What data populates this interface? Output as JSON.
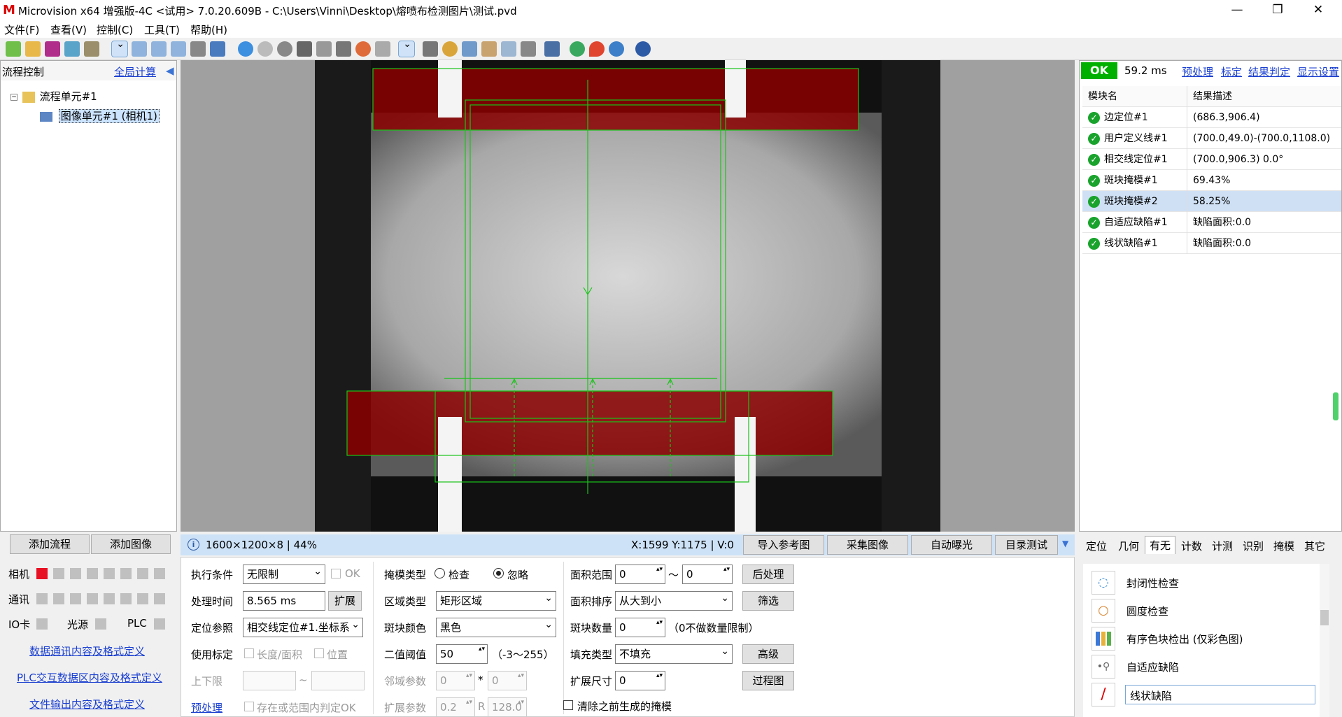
{
  "title_bar": {
    "app_title": "Microvision x64 增强版-4C <试用> 7.0.20.609B - C:\\Users\\Vinni\\Desktop\\熔喷布检测图片\\测试.pvd",
    "minimize": "—",
    "restore": "❐",
    "close": "✕"
  },
  "menu": [
    "文件(F)",
    "查看(V)",
    "控制(C)",
    "工具(T)",
    "帮助(H)"
  ],
  "left_panel": {
    "header": "流程控制",
    "global_calc": "全局计算",
    "collapse_icon": "◀",
    "tree_root": "流程单元#1",
    "tree_child": "图像单元#1 (相机1)"
  },
  "left_bottom": {
    "add_flow": "添加流程",
    "add_image": "添加图像",
    "camera_label": "相机",
    "comm_label": "通讯",
    "io_label": "IO卡",
    "light_label": "光源",
    "plc_label": "PLC",
    "link_comm": "数据通讯内容及格式定义",
    "link_plc": "PLC交互数据区内容及格式定义",
    "link_file": "文件输出内容及格式定义",
    "camera_active_color": "#e81123"
  },
  "status_bar": {
    "info_icon": "i",
    "image_info": "1600×1200×8 | 44%",
    "coords": "X:1599 Y:1175 | V:0",
    "btn_import": "导入参考图",
    "btn_capture": "采集图像",
    "btn_exposure": "自动曝光",
    "btn_dir_test": "目录测试",
    "dropdown_icon": "▼"
  },
  "right_panel": {
    "ok_label": "OK",
    "time": "59.2 ms",
    "links": [
      "预处理",
      "标定",
      "结果判定",
      "显示设置"
    ],
    "col_module": "模块名",
    "col_result": "结果描述",
    "rows": [
      {
        "name": "边定位#1",
        "result": "(686.3,906.4)"
      },
      {
        "name": "用户定义线#1",
        "result": "(700.0,49.0)-(700.0,1108.0)"
      },
      {
        "name": "相交线定位#1",
        "result": "(700.0,906.3) 0.0°"
      },
      {
        "name": "斑块掩模#1",
        "result": "69.43%"
      },
      {
        "name": "斑块掩模#2",
        "result": "58.25%"
      },
      {
        "name": "自适应缺陷#1",
        "result": "缺陷面积:0.0"
      },
      {
        "name": "线状缺陷#1",
        "result": "缺陷面积:0.0"
      }
    ],
    "check_icon": "✓"
  },
  "props": {
    "exec_cond_label": "执行条件",
    "exec_cond_value": "无限制",
    "ok_check": "OK",
    "proc_time_label": "处理时间",
    "proc_time_value": "8.565 ms",
    "expand_btn": "扩展",
    "locate_ref_label": "定位参照",
    "locate_ref_value": "相交线定位#1.坐标系",
    "use_calib_label": "使用标定",
    "length_area": "长度/面积",
    "position": "位置",
    "limits_label": "上下限",
    "tilde": "~",
    "preprocess_link": "预处理",
    "exist_ok": "存在或范围内判定OK",
    "mask_type_label": "掩模类型",
    "radio_check": "检查",
    "radio_ignore": "忽略",
    "region_type_label": "区域类型",
    "region_type_value": "矩形区域",
    "blob_color_label": "斑块颜色",
    "blob_color_value": "黑色",
    "threshold_label": "二值阈值",
    "threshold_value": "50",
    "threshold_range": "（-3～255）",
    "neighbor_label": "邻域参数",
    "neighbor_a": "0",
    "neighbor_star": "*",
    "neighbor_b": "0",
    "expand_param_label": "扩展参数",
    "expand_param_a": "0.2",
    "expand_param_r": "R",
    "expand_param_b": "128.0",
    "area_range_label": "面积范围",
    "area_min": "0",
    "area_tilde": "～",
    "area_max": "0",
    "area_sort_label": "面积排序",
    "area_sort_value": "从大到小",
    "blob_count_label": "斑块数量",
    "blob_count_value": "0",
    "blob_count_note": "（0不做数量限制）",
    "fill_type_label": "填充类型",
    "fill_type_value": "不填充",
    "expand_size_label": "扩展尺寸",
    "expand_size_value": "0",
    "clear_mask": "清除之前生成的掩模",
    "btn_post": "后处理",
    "btn_filter": "筛选",
    "btn_advanced": "高级",
    "btn_process_img": "过程图"
  },
  "tool_tabs": [
    "定位",
    "几何",
    "有无",
    "计数",
    "计测",
    "识别",
    "掩模",
    "其它"
  ],
  "tool_tab_active": "有无",
  "tools": [
    {
      "label": "封闭性检查",
      "icon": "ring-open-icon"
    },
    {
      "label": "圆度检查",
      "icon": "circle-icon"
    },
    {
      "label": "有序色块检出 (仅彩色图)",
      "icon": "color-bars-icon"
    },
    {
      "label": "自适应缺陷",
      "icon": "adaptive-defect-icon"
    },
    {
      "label": "线状缺陷",
      "icon": "line-defect-icon"
    }
  ]
}
